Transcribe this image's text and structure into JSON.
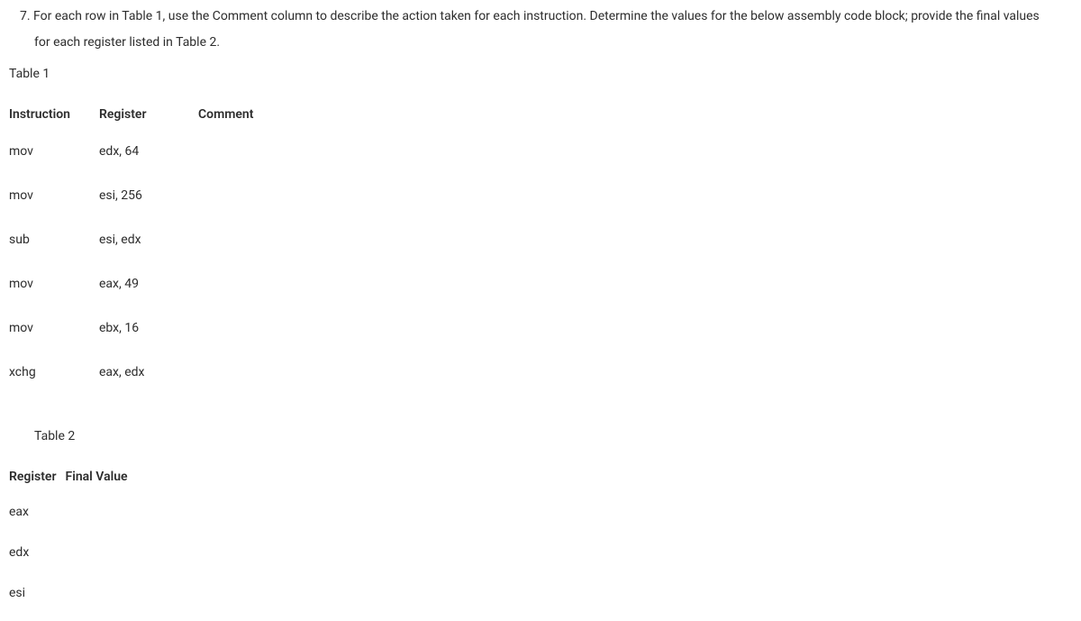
{
  "question": {
    "line1": "7. For each row in Table 1, use the Comment column to describe the action taken for each instruction. Determine the values for the below assembly code block; provide the final values",
    "line2": "for each register listed in Table 2."
  },
  "table1": {
    "label": "Table 1",
    "headers": {
      "instruction": "Instruction",
      "register": "Register",
      "comment": "Comment"
    },
    "rows": [
      {
        "instruction": "mov",
        "register": "edx, 64",
        "comment": ""
      },
      {
        "instruction": "mov",
        "register": "esi, 256",
        "comment": ""
      },
      {
        "instruction": "sub",
        "register": "esi, edx",
        "comment": ""
      },
      {
        "instruction": "mov",
        "register": "eax, 49",
        "comment": ""
      },
      {
        "instruction": "mov",
        "register": "ebx, 16",
        "comment": ""
      },
      {
        "instruction": "xchg",
        "register": "eax, edx",
        "comment": ""
      }
    ]
  },
  "table2": {
    "label": "Table 2",
    "headers": {
      "register": "Register",
      "finalValue": "Final Value"
    },
    "rows": [
      {
        "register": "eax",
        "finalValue": ""
      },
      {
        "register": "edx",
        "finalValue": ""
      },
      {
        "register": "esi",
        "finalValue": ""
      }
    ]
  }
}
